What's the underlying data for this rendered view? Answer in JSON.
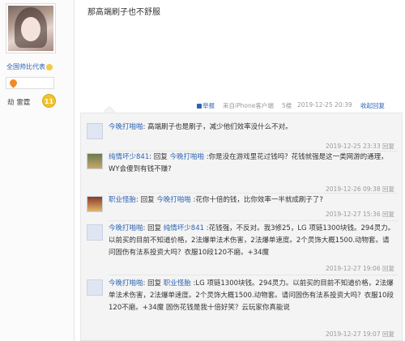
{
  "author": {
    "name": "全国帅比代表",
    "level_name": "劫 雷霆",
    "level": "11"
  },
  "post": {
    "text": "那高端刷子也不舒服",
    "report": "举报",
    "from": "来自iPhone客户端",
    "floor": "5楼",
    "date": "2019-12-25 20:39",
    "collapse": "收起回复"
  },
  "replies": [
    {
      "user": "今晚打啪啪",
      "sep": ":",
      "text": " 高端刷子也是刷子，减少他们效率没什么不对。",
      "time": "2019-12-25 23:33",
      "reply": "回复"
    },
    {
      "user": "纯情坏少841",
      "lead": ": 回复 ",
      "target": "今晚打啪啪",
      "text": " :你是没在游戏里花过钱吗？花钱就强是这一类网游的通理，WY会傻到有钱不赚?",
      "time": "2019-12-26 09:38",
      "reply": "回复"
    },
    {
      "user": "职业怪胎",
      "lead": ": 回复 ",
      "target": "今晚打啪啪",
      "text": " :花你十倍的钱，比你效率一半就成刷子了?",
      "time": "2019-12-27 15:36",
      "reply": "回复"
    },
    {
      "user": "今晚打啪啪",
      "lead": ": 回复 ",
      "target": "纯情坏少841",
      "text": " :花钱强，不反对。我3修25，LG 项链1300块钱。294灵力。以前买的目前不知道价格，2法爆单法术伤害，2法爆单速度。2个灵饰大概1500.动物套。请问固伤有法系投资大吗？衣服10段120不磨。+34魔",
      "time": "2019-12-27 19:06",
      "reply": "回复"
    },
    {
      "user": "今晚打啪啪",
      "lead": ": 回复 ",
      "target": "职业怪胎",
      "text": " :LG 项链1300块钱。294灵力。以前买的目前不知道价格，2法爆单法术伤害，2法爆单速度。2个灵饰大概1500.动物套。请问固伤有法系投资大吗？衣服10段120不磨。+34魔 固伤花钱是我十倍好笑？云玩家你真能说",
      "time": "2019-12-27 19:07",
      "reply": "回复"
    }
  ]
}
